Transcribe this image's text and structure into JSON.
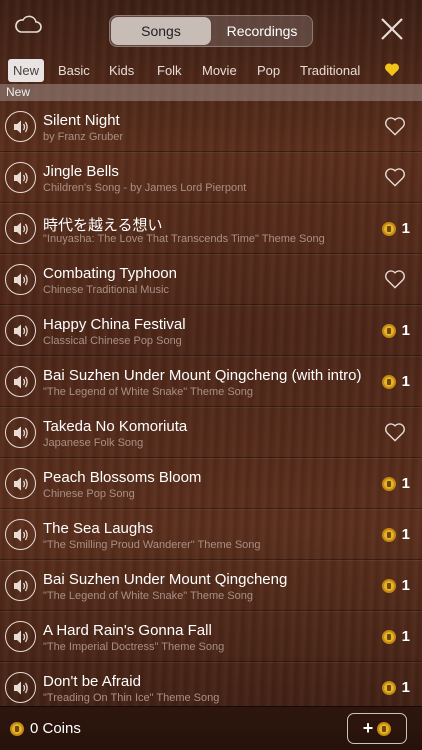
{
  "header": {
    "tabs": [
      {
        "label": "Songs",
        "active": true
      },
      {
        "label": "Recordings",
        "active": false
      }
    ],
    "icons": {
      "cloud": "cloud-icon",
      "close": "close-icon"
    }
  },
  "categories": [
    {
      "label": "New",
      "active": true
    },
    {
      "label": "Basic"
    },
    {
      "label": "Kids"
    },
    {
      "label": "Folk"
    },
    {
      "label": "Movie"
    },
    {
      "label": "Pop"
    },
    {
      "label": "Traditional"
    }
  ],
  "section_title": "New",
  "songs": [
    {
      "title": "Silent Night",
      "subtitle": "by Franz Gruber",
      "price": null
    },
    {
      "title": "Jingle Bells",
      "subtitle": "Children's Song - by James Lord Pierpont",
      "price": null
    },
    {
      "title": "時代を越える想い",
      "subtitle": "\"Inuyasha: The Love That Transcends Time\" Theme Song",
      "price": "1"
    },
    {
      "title": "Combating Typhoon",
      "subtitle": "Chinese Traditional Music",
      "price": null
    },
    {
      "title": "Happy China Festival",
      "subtitle": "Classical Chinese Pop Song",
      "price": "1"
    },
    {
      "title": "Bai Suzhen Under Mount Qingcheng (with intro)",
      "subtitle": "\"The Legend of White Snake\" Theme Song",
      "price": "1"
    },
    {
      "title": "Takeda No Komoriuta",
      "subtitle": "Japanese Folk Song",
      "price": null
    },
    {
      "title": "Peach Blossoms Bloom",
      "subtitle": "Chinese Pop Song",
      "price": "1"
    },
    {
      "title": "The Sea Laughs",
      "subtitle": "\"The Smilling Proud Wanderer\" Theme Song",
      "price": "1"
    },
    {
      "title": "Bai Suzhen Under Mount Qingcheng",
      "subtitle": "\"The Legend of White Snake\" Theme Song",
      "price": "1"
    },
    {
      "title": "A Hard Rain's Gonna Fall",
      "subtitle": "\"The Imperial Doctress\" Theme Song",
      "price": "1"
    },
    {
      "title": "Don't be Afraid",
      "subtitle": "\"Treading On Thin Ice\" Theme Song",
      "price": "1"
    }
  ],
  "footer": {
    "coins_label": "0 Coins",
    "add_label": "+"
  },
  "colors": {
    "coin": "#e9b227",
    "heart_fav": "#f2c318"
  }
}
